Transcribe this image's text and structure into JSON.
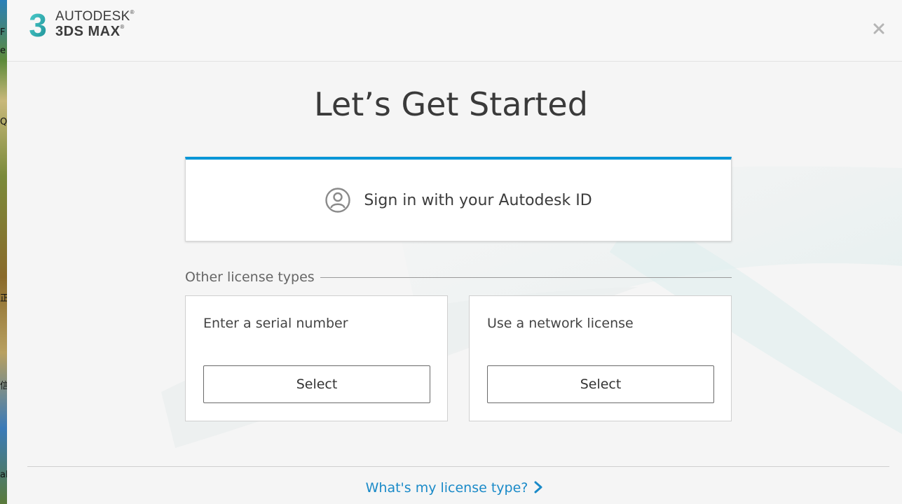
{
  "desktop": {
    "fragments": [
      "F",
      "e",
      "Q",
      "正",
      "信",
      "al"
    ]
  },
  "header": {
    "logo_number": "3",
    "brand_line1": "AUTODESK",
    "brand_line2": "3DS MAX",
    "reg_mark": "®",
    "accent_color": "#2bb5b8"
  },
  "main": {
    "title": "Let’s Get Started",
    "signin": {
      "label": "Sign in with your Autodesk ID",
      "accent_color": "#0696d7"
    },
    "other_license_label": "Other license types",
    "cards": [
      {
        "label": "Enter a serial number",
        "button": "Select"
      },
      {
        "label": "Use a network license",
        "button": "Select"
      }
    ]
  },
  "footer": {
    "link_label": "What's my license type?",
    "link_color": "#1a8ac8"
  },
  "icons": {
    "close": "close-icon",
    "user": "user-circle-icon",
    "chevron": "chevron-right-icon"
  }
}
